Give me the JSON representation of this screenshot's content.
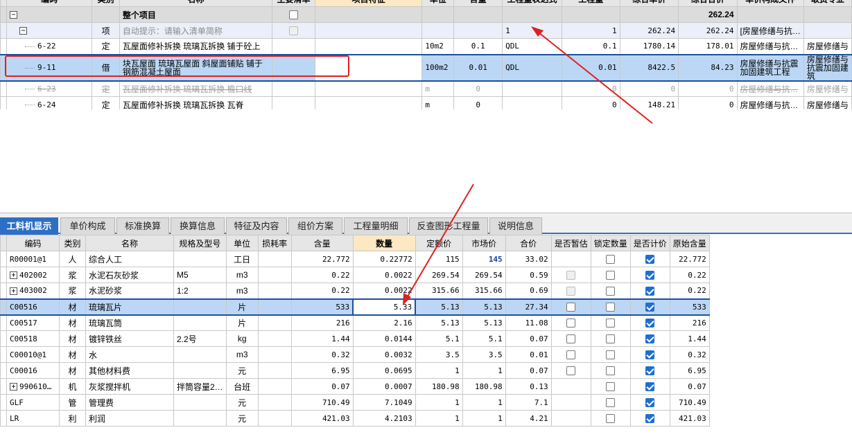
{
  "top_grid": {
    "headers": [
      "编码",
      "类别",
      "名称",
      "主要清单",
      "项目特征",
      "单位",
      "含量",
      "工程量表达式",
      "工程量",
      "综合单价",
      "综合合价",
      "单价构成文件",
      "取费专业"
    ],
    "whole_project": {
      "collapse": "−",
      "name": "整个项目",
      "total": "262.24"
    },
    "item_row": {
      "collapse": "−",
      "type": "项",
      "name": "自动提示：请输入清单简称",
      "expr": "1",
      "qty": "1",
      "unit_price": "262.24",
      "total_price": "262.24",
      "price_file": "[房屋修缮与抗…"
    },
    "rows": [
      {
        "code": "6-22",
        "type": "定",
        "name": "瓦屋面修补拆换 琉璃瓦拆换 铺于砼上",
        "unit": "10m2",
        "content": "0.1",
        "expr": "QDL",
        "qty": "0.1",
        "unit_price": "1780.14",
        "total_price": "178.01",
        "price_file": "房屋修缮与抗…",
        "fee": "房屋修缮与"
      },
      {
        "code": "9-11",
        "type": "借",
        "name": "块瓦屋面 琉璃瓦屋面 斜屋面铺贴 铺于钢筋混凝土屋面",
        "unit": "100m2",
        "content": "0.01",
        "expr": "QDL",
        "qty": "0.01",
        "unit_price": "8422.5",
        "total_price": "84.23",
        "price_file": "房屋修缮与抗震加固建筑工程",
        "fee": "房屋修缮与抗震加固建筑"
      },
      {
        "code": "6-23",
        "type": "定",
        "name": "瓦屋面修补拆换 琉璃瓦拆换 檐口线",
        "unit": "m",
        "content": "0",
        "expr": "",
        "qty": "0",
        "unit_price": "0",
        "total_price": "0",
        "price_file": "房屋修缮与抗…",
        "fee": "房屋修缮与"
      },
      {
        "code": "6-24",
        "type": "定",
        "name": "瓦屋面修补拆换 琉璃瓦拆换 瓦脊",
        "unit": "m",
        "content": "0",
        "expr": "",
        "qty": "0",
        "unit_price": "148.21",
        "total_price": "0",
        "price_file": "房屋修缮与抗…",
        "fee": "房屋修缮与"
      }
    ]
  },
  "tabs": [
    "工料机显示",
    "单价构成",
    "标准换算",
    "换算信息",
    "特征及内容",
    "组价方案",
    "工程量明细",
    "反查图形工程量",
    "说明信息"
  ],
  "bottom_grid": {
    "headers": [
      "编码",
      "类别",
      "名称",
      "规格及型号",
      "单位",
      "损耗率",
      "含量",
      "数量",
      "定额价",
      "市场价",
      "合价",
      "是否暂估",
      "锁定数量",
      "是否计价",
      "原始含量"
    ],
    "rows": [
      {
        "code": "R00001@1",
        "expand": false,
        "type": "人",
        "name": "综合人工",
        "spec": "",
        "unit": "工日",
        "loss": "",
        "content": "22.772",
        "qty": "0.22772",
        "quota": "115",
        "market": "145",
        "total": "33.02",
        "est": "none",
        "lock": "off",
        "price": "on",
        "orig": "22.772"
      },
      {
        "code": "402002",
        "expand": true,
        "type": "浆",
        "name": "水泥石灰砂浆",
        "spec": "M5",
        "unit": "m3",
        "loss": "",
        "content": "0.22",
        "qty": "0.0022",
        "quota": "269.54",
        "market": "269.54",
        "total": "0.59",
        "est": "dis",
        "lock": "off",
        "price": "on",
        "orig": "0.22"
      },
      {
        "code": "403002",
        "expand": true,
        "type": "浆",
        "name": "水泥砂浆",
        "spec": "1:2",
        "unit": "m3",
        "loss": "",
        "content": "0.22",
        "qty": "0.0022",
        "quota": "315.66",
        "market": "315.66",
        "total": "0.69",
        "est": "dis",
        "lock": "off",
        "price": "on",
        "orig": "0.22"
      },
      {
        "code": "C00516",
        "expand": false,
        "type": "材",
        "name": "琉璃瓦片",
        "spec": "",
        "unit": "片",
        "loss": "",
        "content": "533",
        "qty": "5.33",
        "quota": "5.13",
        "market": "5.13",
        "total": "27.34",
        "est": "off",
        "lock": "off",
        "price": "on",
        "orig": "533"
      },
      {
        "code": "C00517",
        "expand": false,
        "type": "材",
        "name": "琉璃瓦筒",
        "spec": "",
        "unit": "片",
        "loss": "",
        "content": "216",
        "qty": "2.16",
        "quota": "5.13",
        "market": "5.13",
        "total": "11.08",
        "est": "off",
        "lock": "off",
        "price": "on",
        "orig": "216"
      },
      {
        "code": "C00518",
        "expand": false,
        "type": "材",
        "name": "镀锌铁丝",
        "spec": "2.2号",
        "unit": "kg",
        "loss": "",
        "content": "1.44",
        "qty": "0.0144",
        "quota": "5.1",
        "market": "5.1",
        "total": "0.07",
        "est": "off",
        "lock": "off",
        "price": "on",
        "orig": "1.44"
      },
      {
        "code": "C00010@1",
        "expand": false,
        "type": "材",
        "name": "水",
        "spec": "",
        "unit": "m3",
        "loss": "",
        "content": "0.32",
        "qty": "0.0032",
        "quota": "3.5",
        "market": "3.5",
        "total": "0.01",
        "est": "off",
        "lock": "off",
        "price": "on",
        "orig": "0.32"
      },
      {
        "code": "C00016",
        "expand": false,
        "type": "材",
        "name": "其他材料费",
        "spec": "",
        "unit": "元",
        "loss": "",
        "content": "6.95",
        "qty": "0.0695",
        "quota": "1",
        "market": "1",
        "total": "0.07",
        "est": "off",
        "lock": "off",
        "price": "on",
        "orig": "6.95"
      },
      {
        "code": "990610…",
        "expand": true,
        "type": "机",
        "name": "灰浆搅拌机",
        "spec": "拌筒容量2…",
        "unit": "台班",
        "loss": "",
        "content": "0.07",
        "qty": "0.0007",
        "quota": "180.98",
        "market": "180.98",
        "total": "0.13",
        "est": "none",
        "lock": "off",
        "price": "on",
        "orig": "0.07"
      },
      {
        "code": "GLF",
        "expand": false,
        "type": "管",
        "name": "管理费",
        "spec": "",
        "unit": "元",
        "loss": "",
        "content": "710.49",
        "qty": "7.1049",
        "quota": "1",
        "market": "1",
        "total": "7.1",
        "est": "none",
        "lock": "off",
        "price": "on",
        "orig": "710.49"
      },
      {
        "code": "LR",
        "expand": false,
        "type": "利",
        "name": "利润",
        "spec": "",
        "unit": "元",
        "loss": "",
        "content": "421.03",
        "qty": "4.2103",
        "quota": "1",
        "market": "1",
        "total": "4.21",
        "est": "none",
        "lock": "off",
        "price": "on",
        "orig": "421.03"
      }
    ]
  },
  "colors": {
    "accent": "#2d6fc4",
    "selection": "#bcd7f5",
    "annotation": "#e02020",
    "market_price_text": "#1b3fa0"
  }
}
